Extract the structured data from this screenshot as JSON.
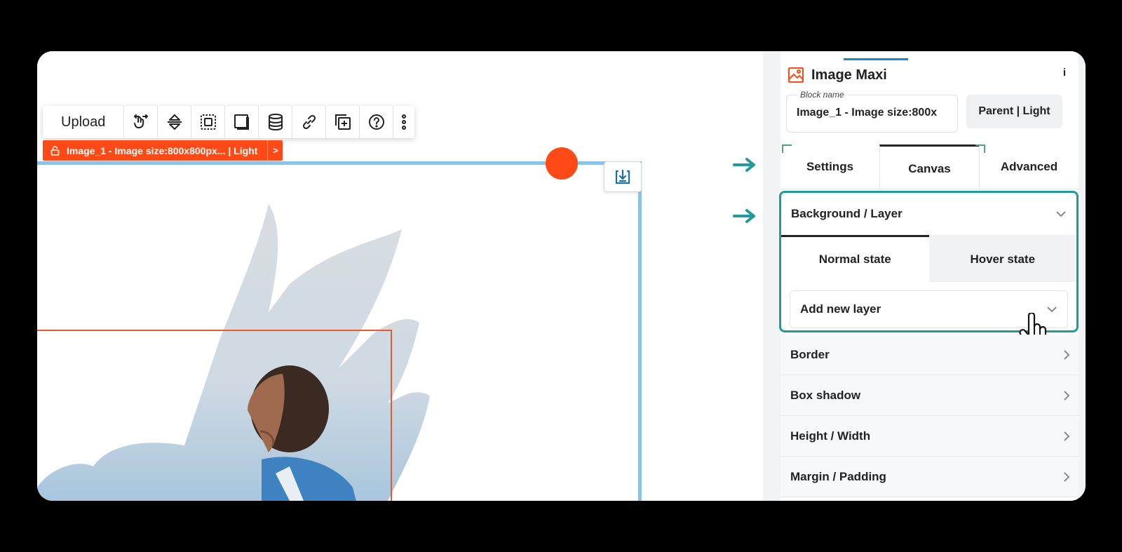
{
  "toolbar": {
    "upload_label": "Upload",
    "icons": [
      "swap-icon",
      "align-icon",
      "padding-icon",
      "shadow-icon",
      "database-icon",
      "link-icon",
      "duplicate-icon",
      "help-icon",
      "more-icon"
    ]
  },
  "block_label": {
    "text": "Image_1 - Image size:800x800px...  | Light",
    "arrow": ">"
  },
  "sidebar": {
    "block_title": "Image Maxi",
    "info": "i",
    "block_name_label": "Block name",
    "block_name_value": "Image_1 - Image size:800x",
    "parent_button": "Parent | Light",
    "tabs": [
      {
        "label": "Settings"
      },
      {
        "label": "Canvas",
        "active": true
      },
      {
        "label": "Advanced"
      }
    ],
    "background_section": {
      "title": "Background / Layer",
      "states": [
        {
          "label": "Normal state"
        },
        {
          "label": "Hover state"
        }
      ],
      "add_layer": "Add new layer"
    },
    "accordions": [
      {
        "label": "Border"
      },
      {
        "label": "Box shadow"
      },
      {
        "label": "Height / Width"
      },
      {
        "label": "Margin / Padding"
      }
    ]
  },
  "colors": {
    "accent_orange": "#ff4a17",
    "selection_blue": "#8cc3e4",
    "teal": "#1f9b9a"
  }
}
